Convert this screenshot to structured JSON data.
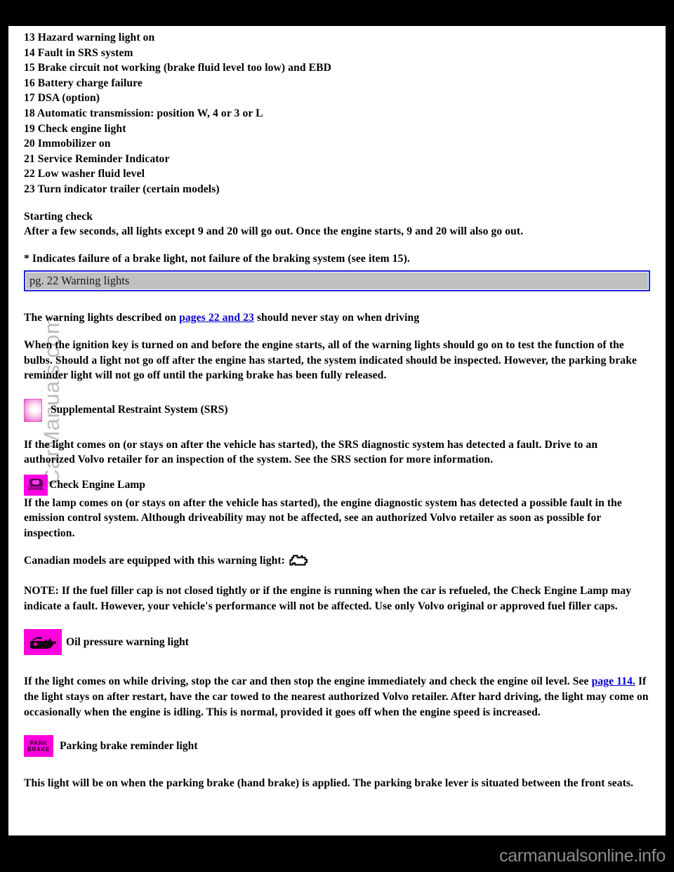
{
  "document": {
    "warning_list": [
      "13 Hazard warning light on",
      "14 Fault in SRS system",
      "15 Brake circuit not working (brake fluid level too low) and EBD",
      "16 Battery charge failure",
      "17 DSA (option)",
      "18 Automatic transmission: position W, 4 or 3 or L",
      "19 Check engine light",
      "20 Immobilizer on",
      "21 Service Reminder Indicator",
      "22 Low washer fluid level",
      "23 Turn indicator trailer (certain models)"
    ],
    "starting_check_heading": "Starting check",
    "starting_check_text": "After a few seconds, all lights except 9 and 20 will go out. Once the engine starts, 9 and 20 will also go out.",
    "footnote": "* Indicates failure of a brake light, not failure of the braking system (see item 15).",
    "page_field": {
      "value": "pg. 22 Warning lights"
    },
    "intro_lead_before": "The warning lights described on ",
    "intro_link": "pages 22 and 23",
    "intro_lead_after": " should never stay on when driving",
    "bulb_test_para": "When the ignition key is turned on and before the engine starts, all of the warning lights should go on to test the function of the bulbs. Should a light not go off after the engine has started, the system indicated should be inspected. However, the parking brake reminder light will not go off until the parking brake has been fully released.",
    "srs": {
      "heading": "Supplemental Restraint System (SRS)",
      "body": "If the light comes on (or stays on after the vehicle has started), the SRS diagnostic system has detected a fault. Drive to an authorized Volvo retailer for an inspection of the system. See the SRS section for more information.",
      "icon": "srs-warning-light-icon"
    },
    "check_engine": {
      "heading": "Check Engine Lamp",
      "body": "If the lamp comes on (or stays on after the vehicle has started), the engine diagnostic system has detected a possible fault in the emission control system. Although driveability may not be affected, see an authorized Volvo retailer as soon as possible for inspection.",
      "canadian_line": "Canadian models are equipped with this warning light:",
      "icon": "check-engine-lamp-icon",
      "tile_text": "ENGINE",
      "note": "NOTE: If the fuel filler cap is not closed tightly or if the engine is running when the car is refueled, the Check Engine Lamp may indicate a fault. However, your vehicle's performance will not be affected. Use only Volvo original or approved fuel filler caps."
    },
    "oil_pressure": {
      "heading": "Oil pressure warning light",
      "body_part1": "If the light comes on while driving, stop the car and then stop the engine immediately and check the engine oil level. See ",
      "body_link": "page 114.",
      "body_part2": " If the light stays on after restart, have the car towed to the nearest authorized Volvo retailer. After hard driving, the light may come on occasionally when the engine is idling. This is normal, provided it goes off when the engine speed is increased.",
      "icon": "oil-pressure-warning-light-icon"
    },
    "parking_brake": {
      "heading": "Parking brake reminder light",
      "body": "This light will be on when the parking brake (hand brake) is applied. The parking brake lever is situated between the front seats.",
      "icon": "parking-brake-reminder-light-icon",
      "tile_line1": "PARK",
      "tile_line2": "BRAKE"
    }
  },
  "watermarks": {
    "side": "CarManuals.com",
    "footer": "carmanualsonline.info"
  },
  "colors": {
    "link": "#0000cc",
    "field_background": "#c0c0c0",
    "field_border": "#2222dd",
    "warning_tile": "#ff00dd",
    "page_background": "#ffffff",
    "canvas_background": "#000000"
  }
}
